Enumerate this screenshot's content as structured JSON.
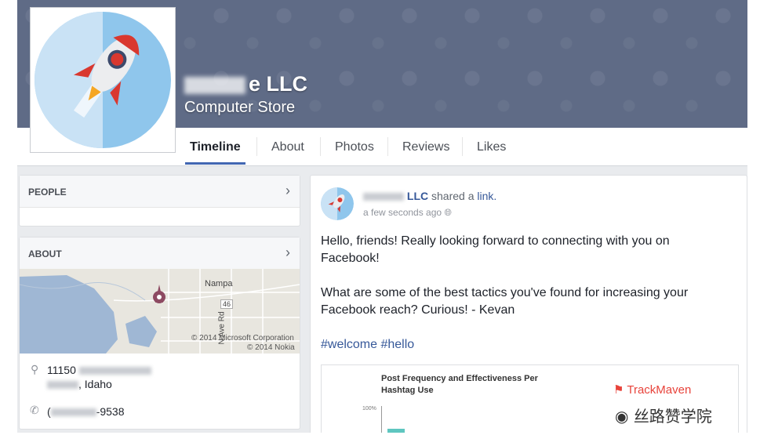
{
  "page": {
    "name_suffix": "e LLC",
    "category": "Computer Store"
  },
  "tabs": [
    {
      "label": "Timeline",
      "active": true
    },
    {
      "label": "About"
    },
    {
      "label": "Photos"
    },
    {
      "label": "Reviews"
    },
    {
      "label": "Likes"
    }
  ],
  "sidebar": {
    "people_title": "PEOPLE",
    "about_title": "ABOUT",
    "map": {
      "city_label": "Nampa",
      "road_label": "46",
      "ave_label": "N Ave Rd",
      "credit_1": "© 2014 Microsoft Corporation",
      "credit_2": "© 2014 Nokia"
    },
    "address_line1_prefix": "11150",
    "address_line2_suffix": ", Idaho",
    "phone_prefix": "(",
    "phone_suffix": "-9538"
  },
  "post": {
    "author_suffix": "LLC",
    "action": " shared a ",
    "link_text": "link.",
    "time": "a few seconds ago",
    "paragraph1": "Hello, friends! Really looking forward to connecting with you on Facebook!",
    "paragraph2": "What are some of the best tactics you've found for increasing your Facebook reach? Curious! - Kevan",
    "hashtags": "#welcome #hello",
    "preview_title": "Post Frequency and Effectiveness Per Hashtag Use",
    "preview_brand": "TrackMaven",
    "preview_axis": "100%"
  },
  "watermark": "丝路赞学院",
  "colors": {
    "cover": "#5f6b86",
    "accent": "#4267b2",
    "link": "#365899",
    "brand": "#e8433b"
  }
}
